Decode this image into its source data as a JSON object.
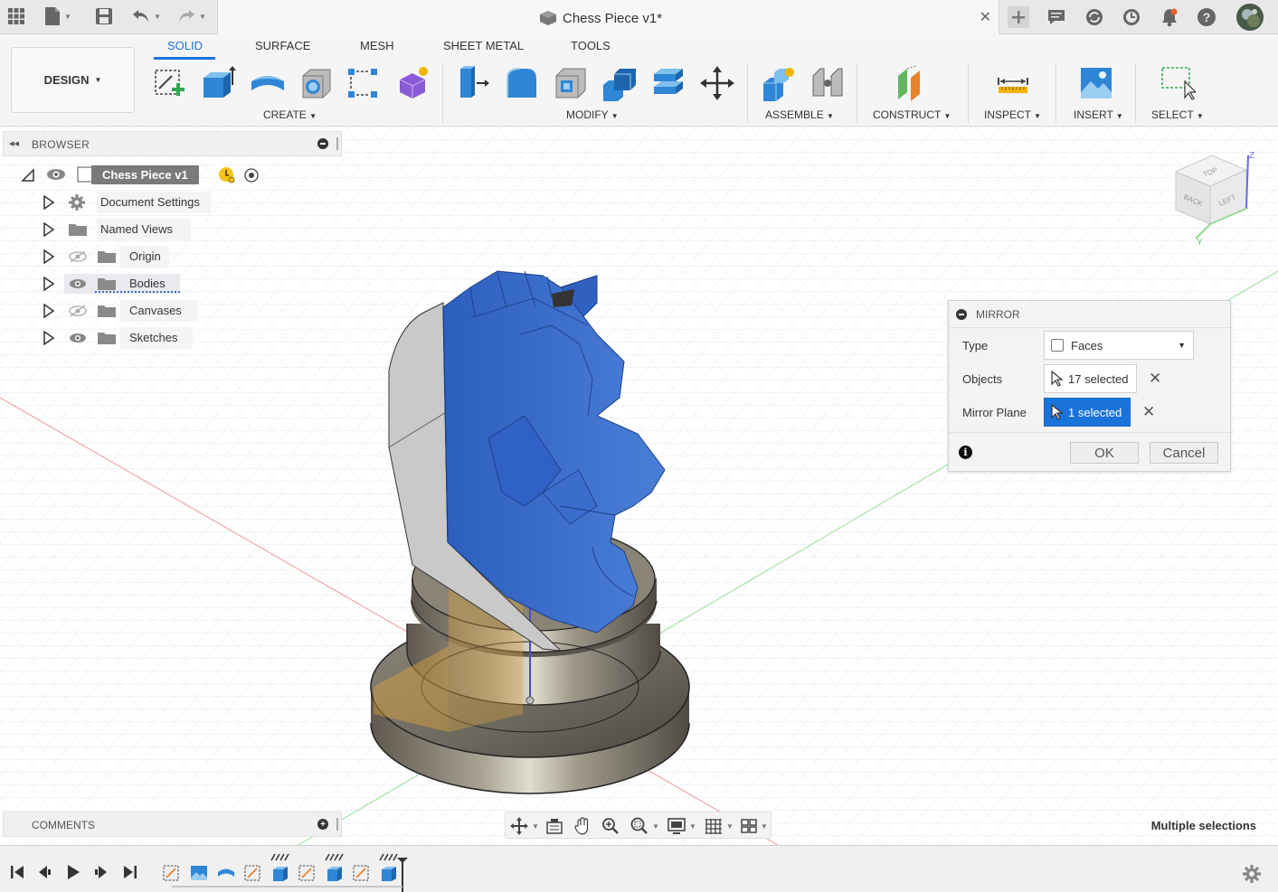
{
  "window": {
    "title": "Chess Piece v1*",
    "close_glyph": "✕"
  },
  "toolbar": {
    "workspace_label": "DESIGN",
    "tabs": [
      "SOLID",
      "SURFACE",
      "MESH",
      "SHEET METAL",
      "TOOLS"
    ],
    "groups": {
      "create": "CREATE",
      "modify": "MODIFY",
      "assemble": "ASSEMBLE",
      "construct": "CONSTRUCT",
      "inspect": "INSPECT",
      "insert": "INSERT",
      "select": "SELECT"
    }
  },
  "browser": {
    "title": "BROWSER",
    "root": "Chess Piece v1",
    "items": [
      "Document Settings",
      "Named Views",
      "Origin",
      "Bodies",
      "Canvases",
      "Sketches"
    ]
  },
  "mirror": {
    "title": "MIRROR",
    "type_label": "Type",
    "type_value": "Faces",
    "objects_label": "Objects",
    "objects_value": "17 selected",
    "plane_label": "Mirror Plane",
    "plane_value": "1 selected",
    "ok": "OK",
    "cancel": "Cancel"
  },
  "viewcube": {
    "top": "TOP",
    "back": "BACK",
    "left": "LEFT",
    "axis_z": "Z",
    "axis_y": "Y"
  },
  "comments": {
    "title": "COMMENTS"
  },
  "status": {
    "text": "Multiple selections"
  },
  "colors": {
    "accent": "#1a73d9",
    "body_blue": "#3a6cc8",
    "base_metal": "#6f6a60",
    "grid_line": "#dde4ee"
  }
}
